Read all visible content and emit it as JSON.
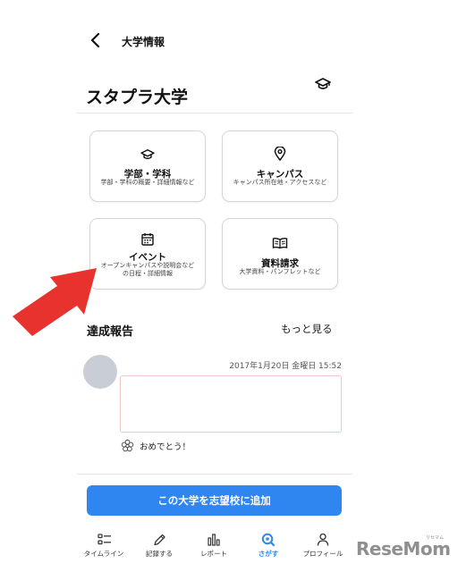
{
  "header": {
    "title": "大学情報"
  },
  "university": {
    "name": "スタプラ大学"
  },
  "cards": [
    {
      "title": "学部・学科",
      "subtitle": "学部・学科の概要・詳細情報など",
      "icon": "graduation-cap-icon"
    },
    {
      "title": "キャンパス",
      "subtitle": "キャンパス所在地・アクセスなど",
      "icon": "location-pin-icon"
    },
    {
      "title": "イベント",
      "subtitle_1": "オープンキャンパスや説明会など",
      "subtitle_2": "の日程・詳細情報",
      "icon": "calendar-icon"
    },
    {
      "title": "資料請求",
      "subtitle": "大学資料・パンフレットなど",
      "icon": "book-icon"
    }
  ],
  "reports": {
    "heading": "達成報告",
    "more": "もっと見る",
    "post": {
      "timestamp": "2017年1月20日 金曜日 15:52",
      "reaction": "おめでとう！"
    }
  },
  "cta": {
    "label": "この大学を志望校に追加"
  },
  "tabbar": [
    {
      "label": "タイムライン",
      "icon": "timeline-icon"
    },
    {
      "label": "記録する",
      "icon": "pencil-icon"
    },
    {
      "label": "レポート",
      "icon": "bar-chart-icon"
    },
    {
      "label": "さがす",
      "icon": "search-icon",
      "active": true
    },
    {
      "label": "プロフィール",
      "icon": "person-icon"
    }
  ],
  "watermark": {
    "brand": "ReseMom",
    "ruby": "リセマム"
  },
  "colors": {
    "accent": "#2f86f0",
    "arrow": "#e8322e",
    "divider": "#e6e6e6"
  }
}
